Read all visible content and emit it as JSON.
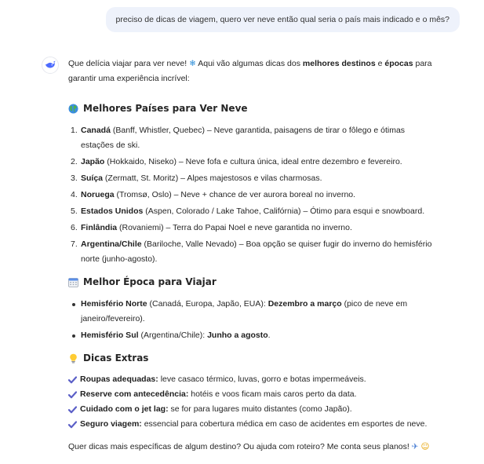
{
  "user_message": "preciso de dicas de viagem, quero ver neve então qual seria o país mais indicado e o mês?",
  "intro": {
    "pre": "Que delícia viajar para ver neve! ",
    "snow": "❄",
    "mid": " Aqui vão algumas dicas dos ",
    "bold1": "melhores destinos",
    "and": " e ",
    "bold2": "épocas",
    "post": " para garantir uma experiência incrível:"
  },
  "sections": {
    "countries": {
      "title": "Melhores Países para Ver Neve",
      "icon": "globe-icon",
      "items": [
        {
          "num": "1.",
          "name": "Canadá",
          "text": " (Banff, Whistler, Quebec) – Neve garantida, paisagens de tirar o fôlego e ótimas estações de ski."
        },
        {
          "num": "2.",
          "name": "Japão",
          "text": " (Hokkaido, Niseko) – Neve fofa e cultura única, ideal entre dezembro e fevereiro."
        },
        {
          "num": "3.",
          "name": "Suíça",
          "text": " (Zermatt, St. Moritz) – Alpes majestosos e vilas charmosas."
        },
        {
          "num": "4.",
          "name": "Noruega",
          "text": " (Tromsø, Oslo) – Neve + chance de ver aurora boreal no inverno."
        },
        {
          "num": "5.",
          "name": "Estados Unidos",
          "text": " (Aspen, Colorado / Lake Tahoe, Califórnia) – Ótimo para esqui e snowboard."
        },
        {
          "num": "6.",
          "name": "Finlândia",
          "text": " (Rovaniemi) – Terra do Papai Noel e neve garantida no inverno."
        },
        {
          "num": "7.",
          "name": "Argentina/Chile",
          "text": " (Bariloche, Valle Nevado) – Boa opção se quiser fugir do inverno do hemisfério norte (junho-agosto)."
        }
      ]
    },
    "season": {
      "title": "Melhor Época para Viajar",
      "icon": "calendar-icon",
      "items": [
        {
          "label": "Hemisfério Norte",
          "detail": " (Canadá, Europa, Japão, EUA): ",
          "bold": "Dezembro a março",
          "rest": " (pico de neve em janeiro/fevereiro)."
        },
        {
          "label": "Hemisfério Sul",
          "detail": " (Argentina/Chile): ",
          "bold": "Junho a agosto",
          "rest": "."
        }
      ]
    },
    "tips": {
      "title": "Dicas Extras",
      "icon": "lightbulb-icon",
      "items": [
        {
          "label": "Roupas adequadas:",
          "text": " leve casaco térmico, luvas, gorro e botas impermeáveis."
        },
        {
          "label": "Reserve com antecedência:",
          "text": " hotéis e voos ficam mais caros perto da data."
        },
        {
          "label": "Cuidado com o jet lag:",
          "text": " se for para lugares muito distantes (como Japão)."
        },
        {
          "label": "Seguro viagem:",
          "text": " essencial para cobertura médica em caso de acidentes em esportes de neve."
        }
      ]
    }
  },
  "closing": "Quer dicas mais específicas de algum destino? Ou ajuda com roteiro? Me conta seus planos! ",
  "closing_emoji_a": "✈",
  "closing_emoji_b": "☺",
  "colors": {
    "user_bubble": "#eef2fb",
    "check": "#5b5fc7",
    "avatar_whale": "#4d6bfe"
  }
}
